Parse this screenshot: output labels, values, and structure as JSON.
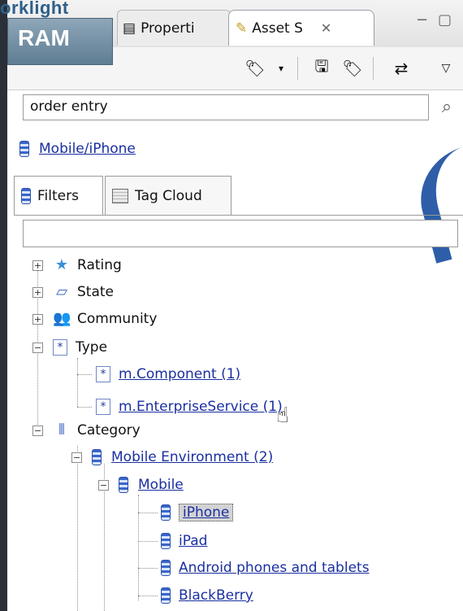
{
  "logo": {
    "top_text": "orklight",
    "box_text": "RAM"
  },
  "tabs": [
    {
      "label": "Properti",
      "icon": "properties-icon"
    },
    {
      "label": "Asset S",
      "icon": "asset-search-icon",
      "close": "✕"
    }
  ],
  "window_controls": {
    "minimize": "−",
    "maximize": "▢"
  },
  "toolbar": {
    "icons": [
      "tag-dropdown-icon",
      "save-icon",
      "tags-icon",
      "sync-icon",
      "menu-icon"
    ]
  },
  "search": {
    "value": "order entry",
    "icon": "search-icon"
  },
  "breadcrumb": {
    "label": "Mobile/iPhone"
  },
  "filter_tabs": [
    {
      "label": "Filters",
      "icon": "db-icon"
    },
    {
      "label": "Tag Cloud",
      "icon": "tag-cloud-icon"
    }
  ],
  "filter_input": {
    "value": ""
  },
  "tree": {
    "rating": "Rating",
    "state": "State",
    "community": "Community",
    "type": "Type",
    "type_children": [
      "m.Component (1)",
      "m.EnterpriseService (1)"
    ],
    "category": "Category",
    "mobile_env": "Mobile Environment (2)",
    "mobile": "Mobile",
    "devices": [
      "iPhone",
      "iPad",
      "Android phones and tablets",
      "BlackBerry"
    ]
  }
}
